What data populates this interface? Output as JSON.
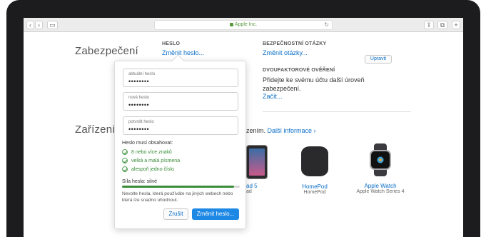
{
  "browser": {
    "url_text": "Apple Inc.",
    "back": "‹",
    "forward": "›",
    "sidebar": "▭",
    "reload": "↻",
    "share": "⇪",
    "tabs": "⧉",
    "new_tab": "+"
  },
  "security": {
    "section_title": "Zabezpečení",
    "password_label": "HESLO",
    "password_link": "Změnit heslo...",
    "questions_label": "BEZPEČNOSTNÍ OTÁZKY",
    "questions_link": "Změnit otázky...",
    "twofactor_label": "DVOUFAKTOROVÉ OVĚŘENÍ",
    "twofactor_text_1": "Přidejte ke svému účtu další úroveň",
    "twofactor_text_2": "zabezpečení.",
    "twofactor_link": "Začít...",
    "edit_button": "Upravit"
  },
  "devices": {
    "section_title": "Zařízení",
    "intro_suffix": "zením.",
    "more_info_link": "Další informace ›",
    "items": [
      {
        "name": "ad 5",
        "sub": "ad",
        "icon": "ipad-icon"
      },
      {
        "name": "HomePod",
        "sub": "HomePod",
        "icon": "homepod-icon"
      },
      {
        "name": "Apple Watch",
        "sub": "Apple Watch Series 4",
        "icon": "apple-watch-icon"
      }
    ]
  },
  "popup": {
    "current_label": "aktuální heslo",
    "current_value": "••••••••",
    "new_label": "nové heslo",
    "new_value": "••••••••",
    "confirm_label": "potvrdit heslo",
    "confirm_value": "••••••••",
    "requirements_title": "Heslo musí obsahovat:",
    "requirements": [
      "8 nebo více znaků",
      "velká a malá písmena",
      "alespoň jedno číslo"
    ],
    "strength_label": "Síla hesla: silné",
    "strength_level": 0.95,
    "hint": "Nevolte hesla, která používáte na jiných webech nebo která lze snadno uhodnout.",
    "cancel_button": "Zrušit",
    "submit_button": "Změnit heslo..."
  }
}
